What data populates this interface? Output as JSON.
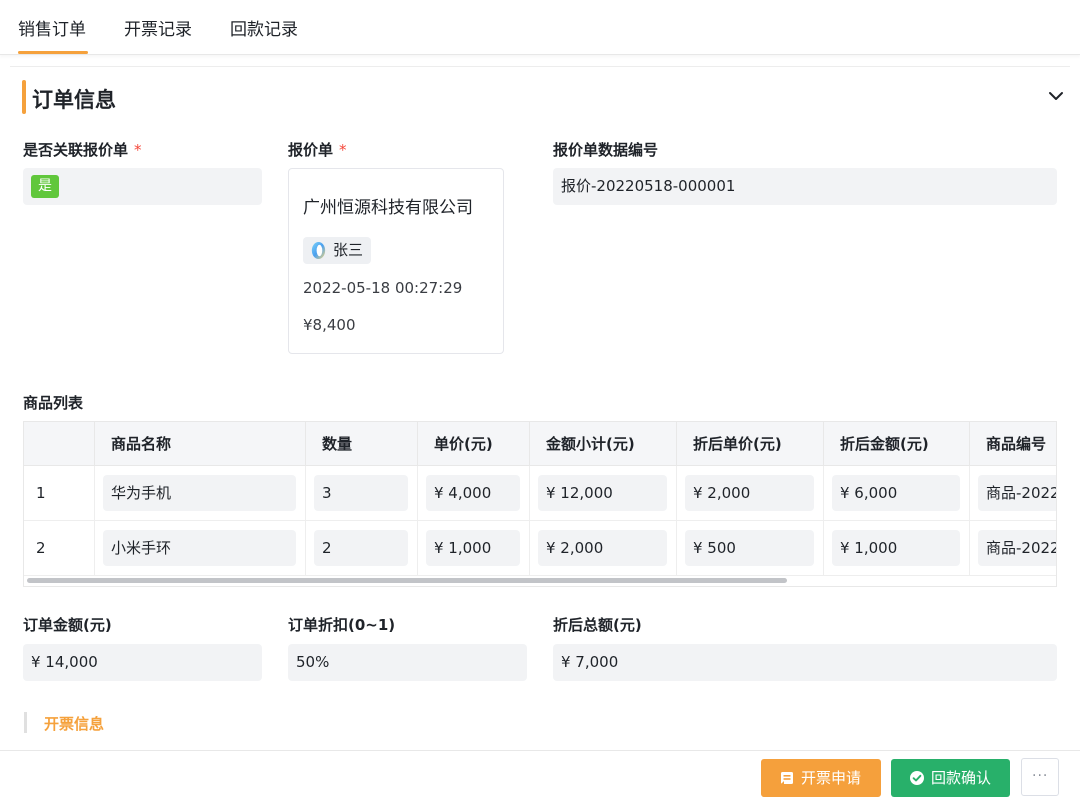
{
  "tabs": [
    {
      "label": "销售订单",
      "active": true
    },
    {
      "label": "开票记录",
      "active": false
    },
    {
      "label": "回款记录",
      "active": false
    }
  ],
  "section": {
    "title": "订单信息"
  },
  "fields": {
    "link_quote": {
      "label": "是否关联报价单",
      "value": "是"
    },
    "quote": {
      "label": "报价单"
    },
    "quote_no": {
      "label": "报价单数据编号",
      "value": "报价-20220518-000001"
    }
  },
  "quote_card": {
    "company": "广州恒源科技有限公司",
    "user": "张三",
    "date": "2022-05-18 00:27:29",
    "amount": "¥8,400"
  },
  "products": {
    "label": "商品列表",
    "columns": [
      "商品名称",
      "数量",
      "单价(元)",
      "金额小计(元)",
      "折后单价(元)",
      "折后金额(元)",
      "商品编号"
    ],
    "rows": [
      {
        "idx": "1",
        "name": "华为手机",
        "qty": "3",
        "price": "¥ 4,000",
        "subtotal": "¥ 12,000",
        "disc_price": "¥ 2,000",
        "disc_amount": "¥ 6,000",
        "code": "商品-2022"
      },
      {
        "idx": "2",
        "name": "小米手环",
        "qty": "2",
        "price": "¥ 1,000",
        "subtotal": "¥ 2,000",
        "disc_price": "¥ 500",
        "disc_amount": "¥ 1,000",
        "code": "商品-2022"
      }
    ]
  },
  "summary": {
    "order_amount": {
      "label": "订单金额(元)",
      "value": "¥ 14,000"
    },
    "discount": {
      "label": "订单折扣(0~1)",
      "value": "50%"
    },
    "discount_total": {
      "label": "折后总额(元)",
      "value": "¥ 7,000"
    }
  },
  "subsection": {
    "title": "开票信息"
  },
  "actions": {
    "invoice": "开票申请",
    "confirm": "回款确认",
    "more": "···"
  },
  "colors": {
    "accent": "#f5a13c",
    "confirm": "#28b06a",
    "tag": "#61c73c",
    "required": "#f5483b"
  }
}
